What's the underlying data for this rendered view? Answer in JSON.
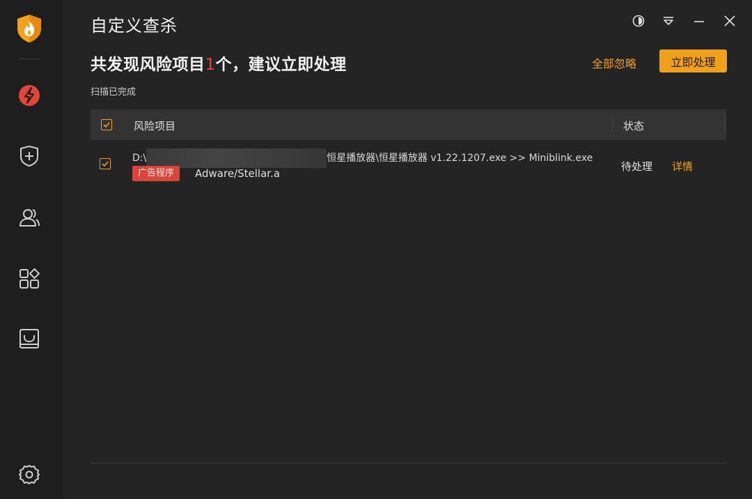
{
  "window": {
    "title": "自定义查杀"
  },
  "summary": {
    "prefix": "共发现风险项目",
    "count": "1",
    "suffix": "个，建议立即处理",
    "status": "扫描已完成"
  },
  "actions": {
    "ignore_all": "全部忽略",
    "process_now": "立即处理"
  },
  "table": {
    "headers": {
      "risk": "风险项目",
      "status": "状态"
    },
    "rows": [
      {
        "path_prefix": "D:\\",
        "path_suffix": "恒星播放器\\恒星播放器 v1.22.1207.exe >> Miniblink.exe",
        "tag": "广告程序",
        "threat": "Adware/Stellar.a",
        "status": "待处理",
        "detail": "详情"
      }
    ]
  },
  "sidebar": {
    "items": [
      {
        "icon": "flash-scan-icon"
      },
      {
        "icon": "shield-plus-icon"
      },
      {
        "icon": "users-icon"
      },
      {
        "icon": "apps-grid-icon"
      },
      {
        "icon": "inbox-tray-icon"
      },
      {
        "icon": "settings-gear-icon"
      }
    ]
  },
  "colors": {
    "accent": "#f0a01a",
    "danger": "#d9453a",
    "background": "#242424",
    "sidebar": "#1e1e1e"
  }
}
